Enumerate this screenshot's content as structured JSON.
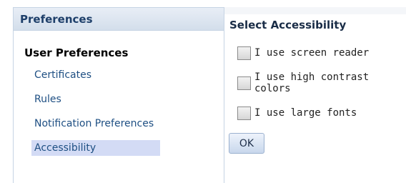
{
  "left_panel": {
    "title": "Preferences",
    "section_title": "User Preferences",
    "items": [
      {
        "label": "Certificates"
      },
      {
        "label": "Rules"
      },
      {
        "label": "Notification Preferences"
      },
      {
        "label": "Accessibility",
        "selected": true
      }
    ]
  },
  "right_panel": {
    "title": "Select Accessibility",
    "options": [
      {
        "label": "I use screen reader",
        "checked": false
      },
      {
        "label": "I use high contrast colors",
        "checked": false
      },
      {
        "label": "I use large fonts",
        "checked": false
      }
    ],
    "ok_label": "OK"
  },
  "colors": {
    "header_text": "#1e3f6a",
    "link_text": "#1e4f83",
    "selected_bg": "#d3dbf5",
    "panel_border": "#c6d4e4"
  }
}
